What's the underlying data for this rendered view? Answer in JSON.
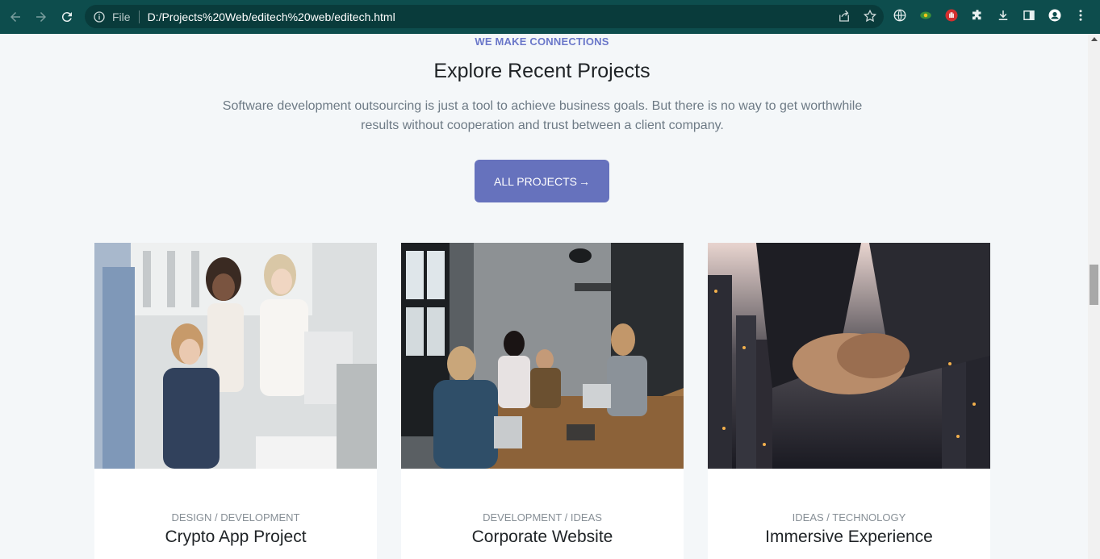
{
  "browser": {
    "file_label": "File",
    "url": "D:/Projects%20Web/editech%20web/editech.html"
  },
  "section": {
    "eyebrow": "WE MAKE CONNECTIONS",
    "title": "Explore Recent Projects",
    "lead_line1": "Software development outsourcing is just a tool to achieve business goals. But there is no way to get worthwhile",
    "lead_line2": "results without cooperation and trust between a client company.",
    "cta_label": "ALL PROJECTS",
    "cta_arrow": "→"
  },
  "projects": [
    {
      "category": "DESIGN / DEVELOPMENT",
      "name": "Crypto App Project"
    },
    {
      "category": "DEVELOPMENT / IDEAS",
      "name": "Corporate Website"
    },
    {
      "category": "IDEAS / TECHNOLOGY",
      "name": "Immersive Experience"
    }
  ],
  "colors": {
    "chrome": "#0d4d4d",
    "accent": "#6672bd",
    "eyebrow": "#6a77c9",
    "page_bg": "#f4f7f9"
  }
}
